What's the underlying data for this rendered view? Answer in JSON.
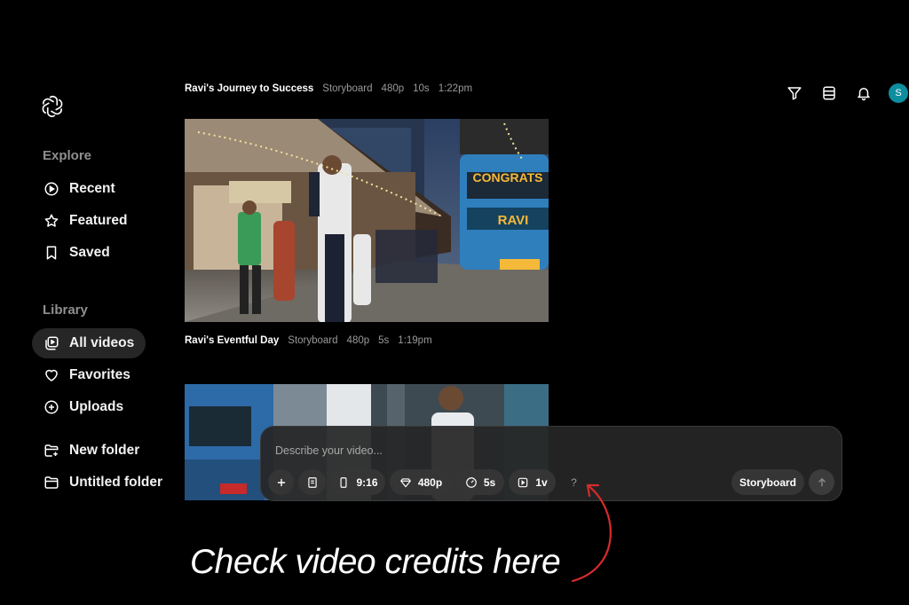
{
  "sidebar": {
    "explore_label": "Explore",
    "library_label": "Library",
    "items": [
      {
        "label": "Recent"
      },
      {
        "label": "Featured"
      },
      {
        "label": "Saved"
      },
      {
        "label": "All videos"
      },
      {
        "label": "Favorites"
      },
      {
        "label": "Uploads"
      },
      {
        "label": "New folder"
      },
      {
        "label": "Untitled folder"
      }
    ]
  },
  "videos": [
    {
      "title": "Ravi's Journey to Success",
      "type": "Storyboard",
      "resolution": "480p",
      "duration": "10s",
      "time": "1:22pm"
    },
    {
      "title": "Ravi's Eventful Day",
      "type": "Storyboard",
      "resolution": "480p",
      "duration": "5s",
      "time": "1:19pm"
    }
  ],
  "bus_sign": {
    "line1": "CONGRATS",
    "line2": "RAVI"
  },
  "header": {
    "avatar_initial": "S"
  },
  "composer": {
    "placeholder": "Describe your video...",
    "aspect": "9:16",
    "resolution": "480p",
    "duration": "5s",
    "variations": "1v",
    "help": "?",
    "mode": "Storyboard"
  },
  "annotation": {
    "text": "Check video credits here",
    "color": "#d62b2b"
  },
  "colors": {
    "accent": "#0d8ea0",
    "background": "#000000"
  }
}
